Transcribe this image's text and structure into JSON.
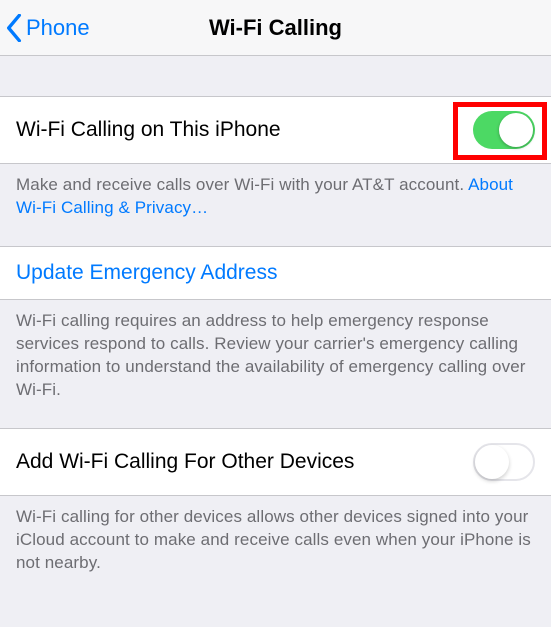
{
  "navbar": {
    "back_label": "Phone",
    "title": "Wi-Fi Calling"
  },
  "row1": {
    "label": "Wi-Fi Calling on This iPhone",
    "toggle_on": true,
    "highlighted": true
  },
  "footer1": {
    "text": "Make and receive calls over Wi-Fi with your AT&T account.",
    "link": "About Wi-Fi Calling & Privacy…"
  },
  "row2": {
    "label": "Update Emergency Address"
  },
  "footer2": {
    "text": "Wi-Fi calling requires an address to help emergency response services respond to calls. Review your carrier's emergency calling information to understand the availability of emergency calling over Wi-Fi."
  },
  "row3": {
    "label": "Add Wi-Fi Calling For Other Devices",
    "toggle_on": false
  },
  "footer3": {
    "text": "Wi-Fi calling for other devices allows other devices signed into your iCloud account to make and receive calls even when your iPhone is not nearby."
  },
  "highlight": {
    "color": "#ff0000"
  }
}
